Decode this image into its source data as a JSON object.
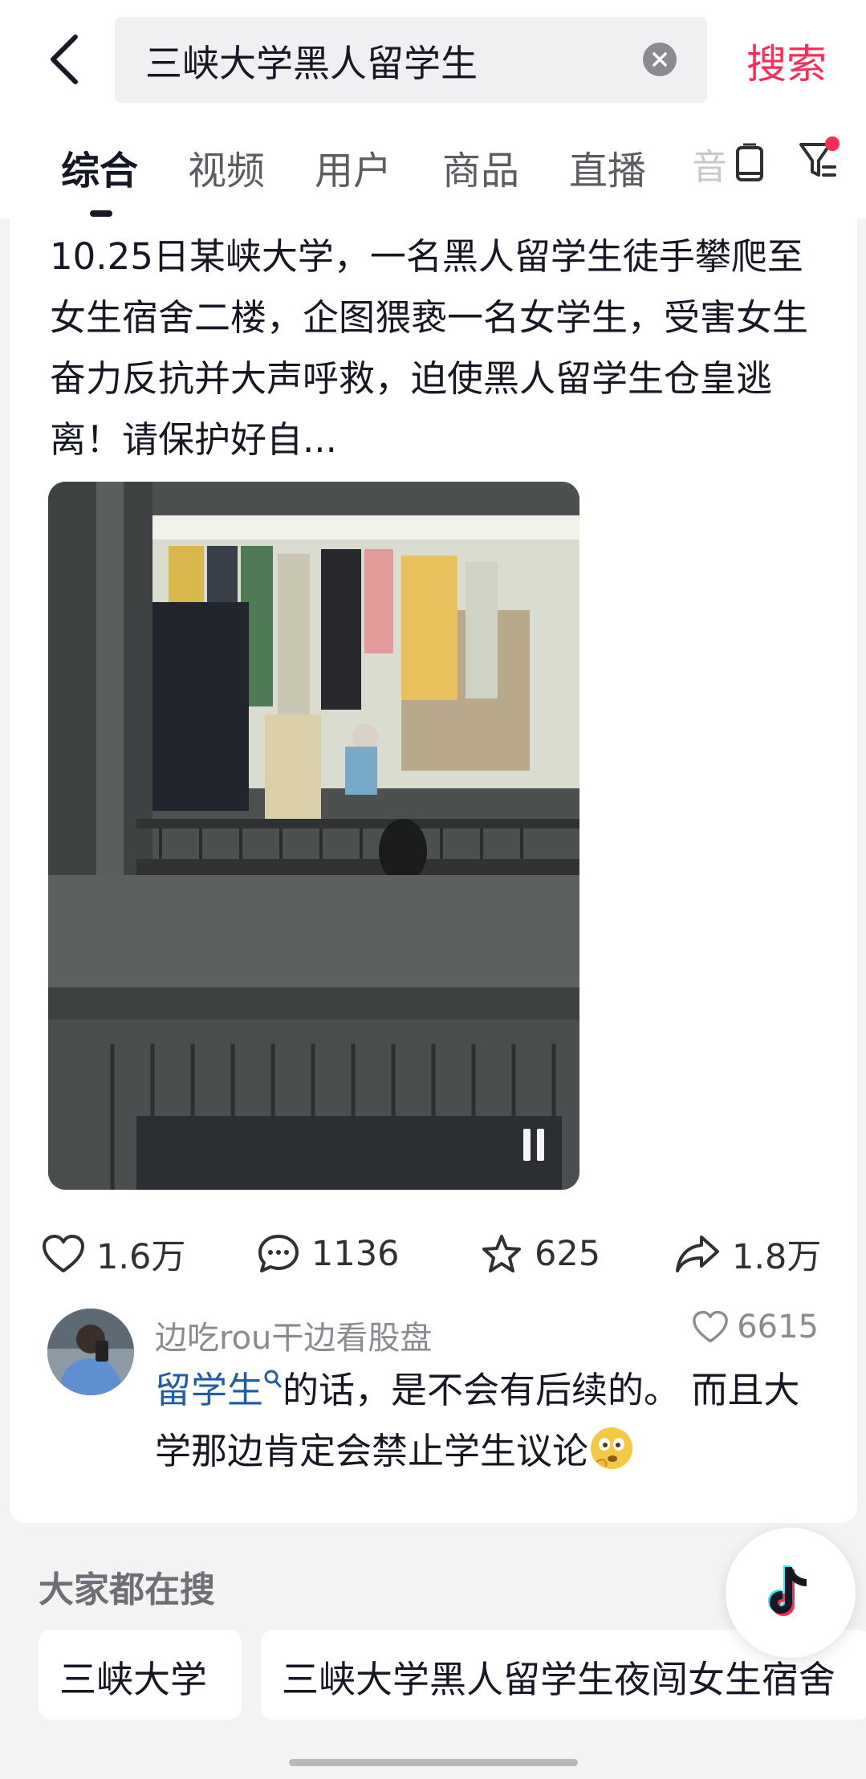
{
  "search": {
    "query": "三峡大学黑人留学生",
    "button_label": "搜索"
  },
  "tabs": [
    "综合",
    "视频",
    "用户",
    "商品",
    "直播"
  ],
  "tab_partial": "音",
  "post": {
    "caption": "10.25日某峡大学，一名黑人留学生徒手攀爬至女生宿舍二楼，企图猥亵一名女学生，受害女生奋力反抗并大声呼救，迫使黑人留学生仓皇逃离！请保护好自...",
    "likes": "1.6万",
    "comments": "1136",
    "favorites": "625",
    "shares": "1.8万"
  },
  "top_comment": {
    "user": "边吃rou干边看股盘",
    "likes": "6615",
    "link_text": "留学生",
    "text": "的话，是不会有后续的。 而且大学那边肯定会禁止学生议论"
  },
  "trending": {
    "title": "大家都在搜",
    "chips": [
      "三峡大学",
      "三峡大学黑人留学生夜闯女生宿舍"
    ]
  },
  "colors": {
    "accent": "#fe2c55",
    "link": "#235ca6"
  }
}
